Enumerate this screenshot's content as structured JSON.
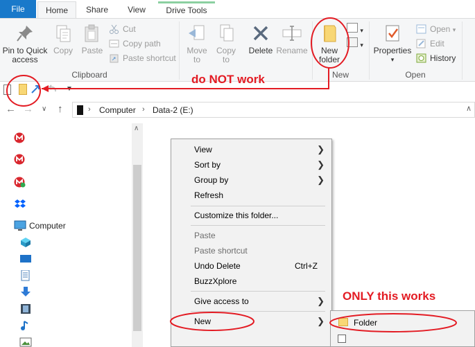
{
  "tabs": {
    "file": "File",
    "home": "Home",
    "share": "Share",
    "view": "View",
    "drive_tools": "Drive Tools"
  },
  "ribbon": {
    "clipboard": {
      "pin_line1": "Pin to Quick",
      "pin_line2": "access",
      "copy": "Copy",
      "paste": "Paste",
      "cut": "Cut",
      "copy_path": "Copy path",
      "paste_shortcut": "Paste shortcut",
      "group": "Clipboard"
    },
    "organize": {
      "move_line1": "Move",
      "move_line2": "to",
      "copy_line1": "Copy",
      "copy_line2": "to",
      "delete": "Delete",
      "rename": "Rename"
    },
    "new": {
      "nf_line1": "New",
      "nf_line2": "folder",
      "group": "New"
    },
    "open": {
      "properties": "Properties",
      "open": "Open",
      "edit": "Edit",
      "history": "History",
      "group": "Open"
    }
  },
  "address": {
    "computer": "Computer",
    "drive": "Data-2 (E:)"
  },
  "nav": {
    "computer": "Computer"
  },
  "context_menu": {
    "view": "View",
    "sort_by": "Sort by",
    "group_by": "Group by",
    "refresh": "Refresh",
    "customize": "Customize this folder...",
    "paste": "Paste",
    "paste_shortcut": "Paste shortcut",
    "undo_delete": "Undo Delete",
    "undo_shortcut": "Ctrl+Z",
    "buzzxplore": "BuzzXplore",
    "give_access": "Give access to",
    "new": "New"
  },
  "submenu": {
    "folder": "Folder"
  },
  "annotations": {
    "not_work": "do NOT work",
    "only_works": "ONLY this works"
  },
  "colors": {
    "file_tab": "#1979ca",
    "annotation": "#e31b23",
    "folder": "#f8d775",
    "mega": "#d9272e"
  }
}
